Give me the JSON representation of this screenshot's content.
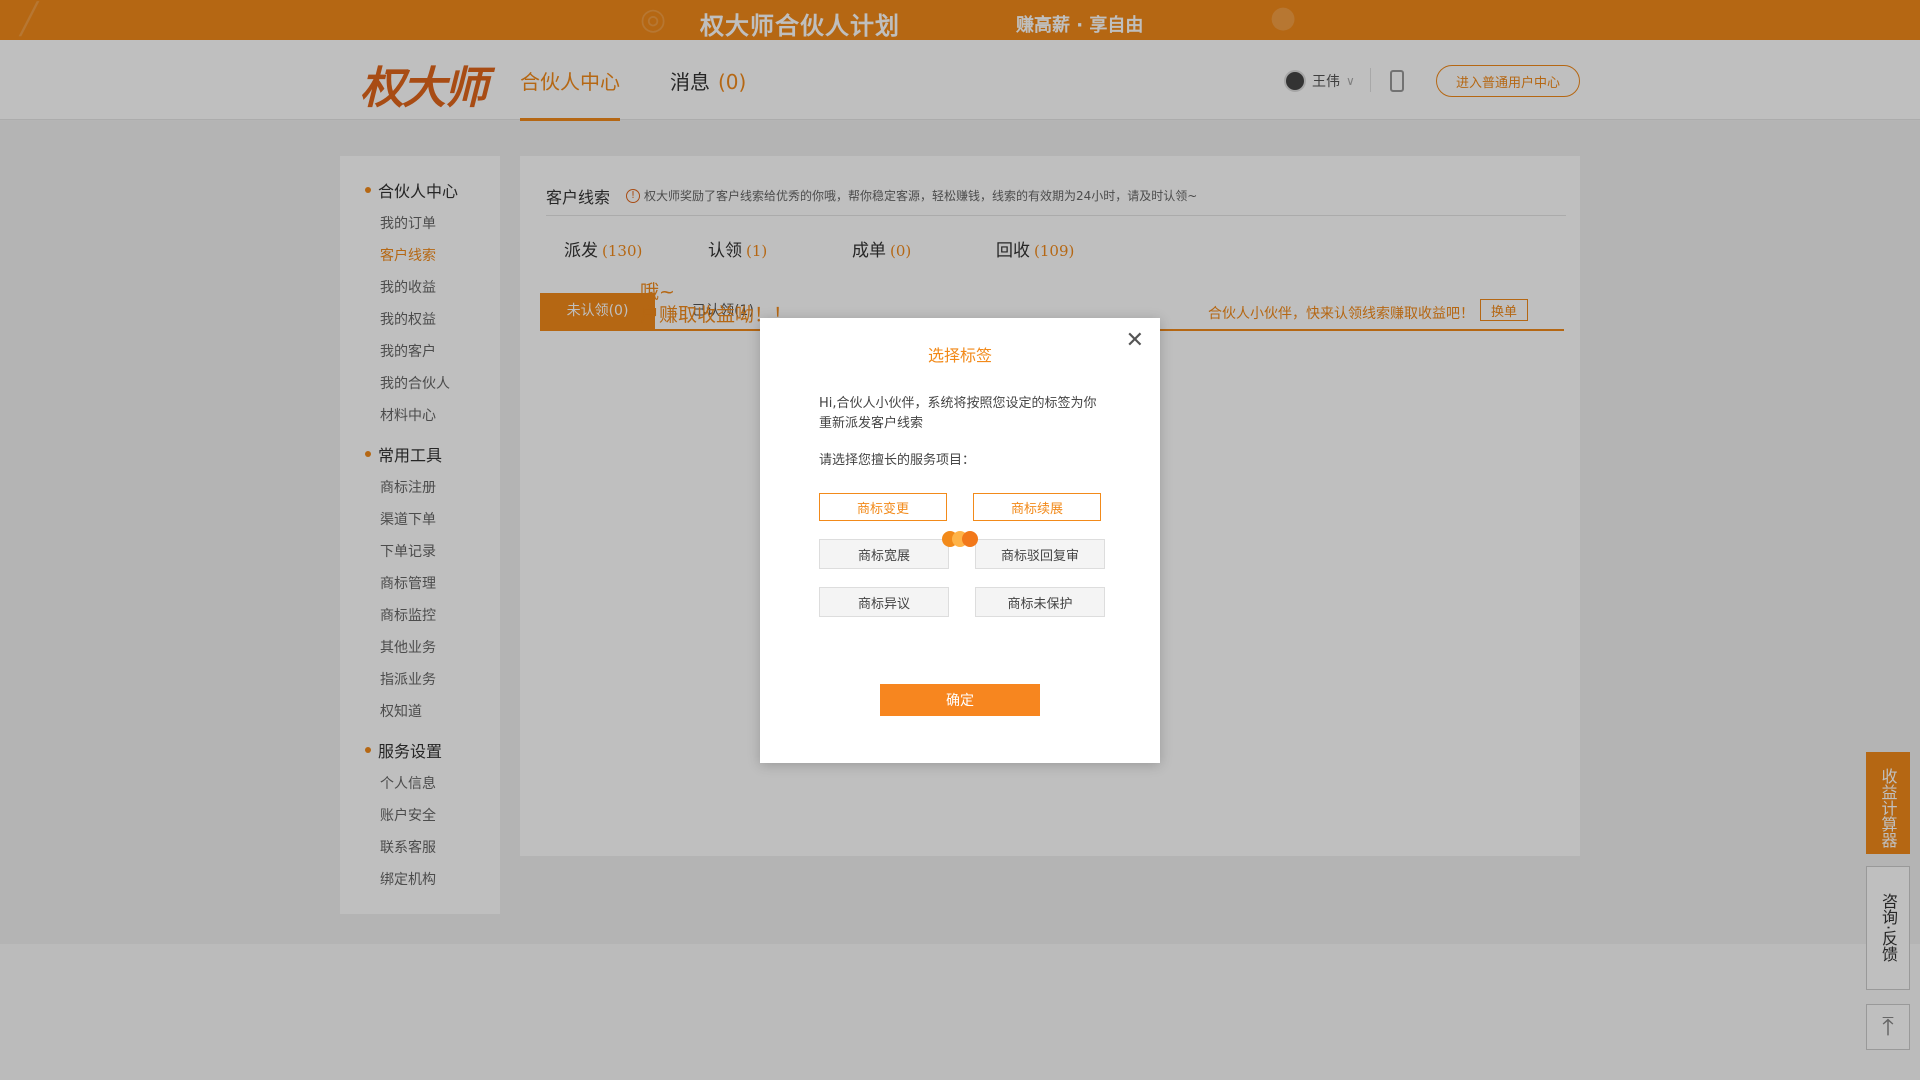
{
  "banner": {
    "title": "权大师合伙人计划",
    "slogan": "赚高薪 · 享自由"
  },
  "header": {
    "logo": "权大师",
    "nav": {
      "partner_center": "合伙人中心",
      "messages": "消息",
      "messages_count": "(0)"
    },
    "user_name": "王伟",
    "enter_button": "进入普通用户中心"
  },
  "sidebar": {
    "group1": {
      "title": "合伙人中心",
      "items": [
        "我的订单",
        "客户线索",
        "我的收益",
        "我的权益",
        "我的客户",
        "我的合伙人",
        "材料中心"
      ]
    },
    "group2": {
      "title": "常用工具",
      "items": [
        "商标注册",
        "渠道下单",
        "下单记录",
        "商标管理",
        "商标监控",
        "其他业务",
        "指派业务",
        "权知道"
      ]
    },
    "group3": {
      "title": "服务设置",
      "items": [
        "个人信息",
        "账户安全",
        "联系客服",
        "绑定机构"
      ]
    },
    "active_item": "客户线索"
  },
  "main": {
    "title": "客户线索",
    "notice": "权大师奖励了客户线索给优秀的你哦，帮你稳定客源，轻松赚钱，线索的有效期为24小时，请及时认领~",
    "stats": [
      {
        "label": "派发",
        "num": "(130)"
      },
      {
        "label": "认领",
        "num": "(1)"
      },
      {
        "label": "成单",
        "num": "(0)"
      },
      {
        "label": "回收",
        "num": "(109)"
      }
    ],
    "tabs": {
      "unclaimed": "未认领(0)",
      "claimed": "已认领(1)"
    },
    "hint": "合伙人小伙伴，快来认领线索赚取收益吧！",
    "swap": "换单",
    "empty_line1": "哦~",
    "empty_line2": "户赚取收益呦！！"
  },
  "float": {
    "calculator": "收益计算器",
    "consult": "咨询·反馈"
  },
  "modal": {
    "title": "选择标签",
    "intro": "Hi,合伙人小伙伴，系统将按照您设定的标签为你重新派发客户线索",
    "prompt": "请选择您擅长的服务项目：",
    "tags": [
      {
        "label": "商标变更",
        "selected": true
      },
      {
        "label": "商标续展",
        "selected": true
      },
      {
        "label": "商标宽展",
        "selected": false
      },
      {
        "label": "商标驳回复审",
        "selected": false
      },
      {
        "label": "商标异议",
        "selected": false
      },
      {
        "label": "商标未保护",
        "selected": false
      }
    ],
    "confirm": "确定"
  },
  "colors": {
    "accent": "#f28a1a",
    "banner": "#f28a1a"
  }
}
